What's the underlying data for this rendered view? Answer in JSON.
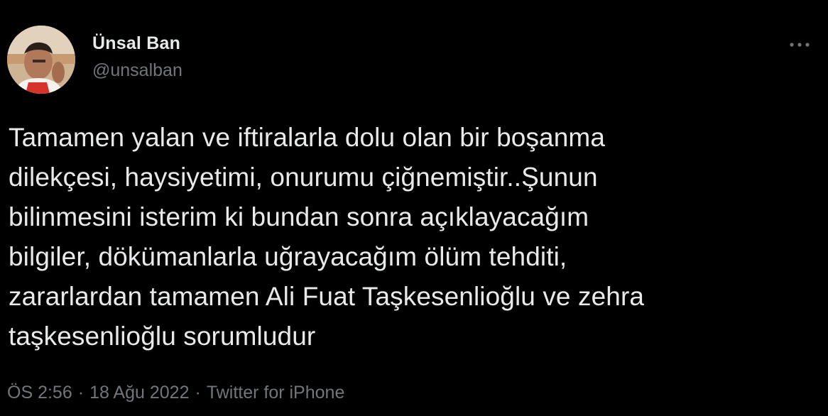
{
  "tweet": {
    "author": {
      "display_name": "Ünsal Ban",
      "handle": "@unsalban",
      "avatar_icon": "profile-photo"
    },
    "more_icon": "more-horizontal-icon",
    "text": "Tamamen yalan ve iftiralarla dolu olan bir boşanma\ndilekçesi,  haysiyetimi, onurumu çiğnemiştir..Şunun\nbilinmesini isterim ki bundan sonra açıklayacağım\nbilgiler, dökümanlarla uğrayacağım ölüm tehditi,\nzararlardan tamamen Ali Fuat Taşkesenlioğlu ve zehra\ntaşkesenlioğlu sorumludur",
    "meta": {
      "time": "ÖS 2:56",
      "separator": "·",
      "date": "18 Ağu 2022",
      "source": "Twitter for iPhone"
    }
  },
  "colors": {
    "background": "#000000",
    "primary_text": "#e7e9ea",
    "secondary_text": "#71767b"
  }
}
